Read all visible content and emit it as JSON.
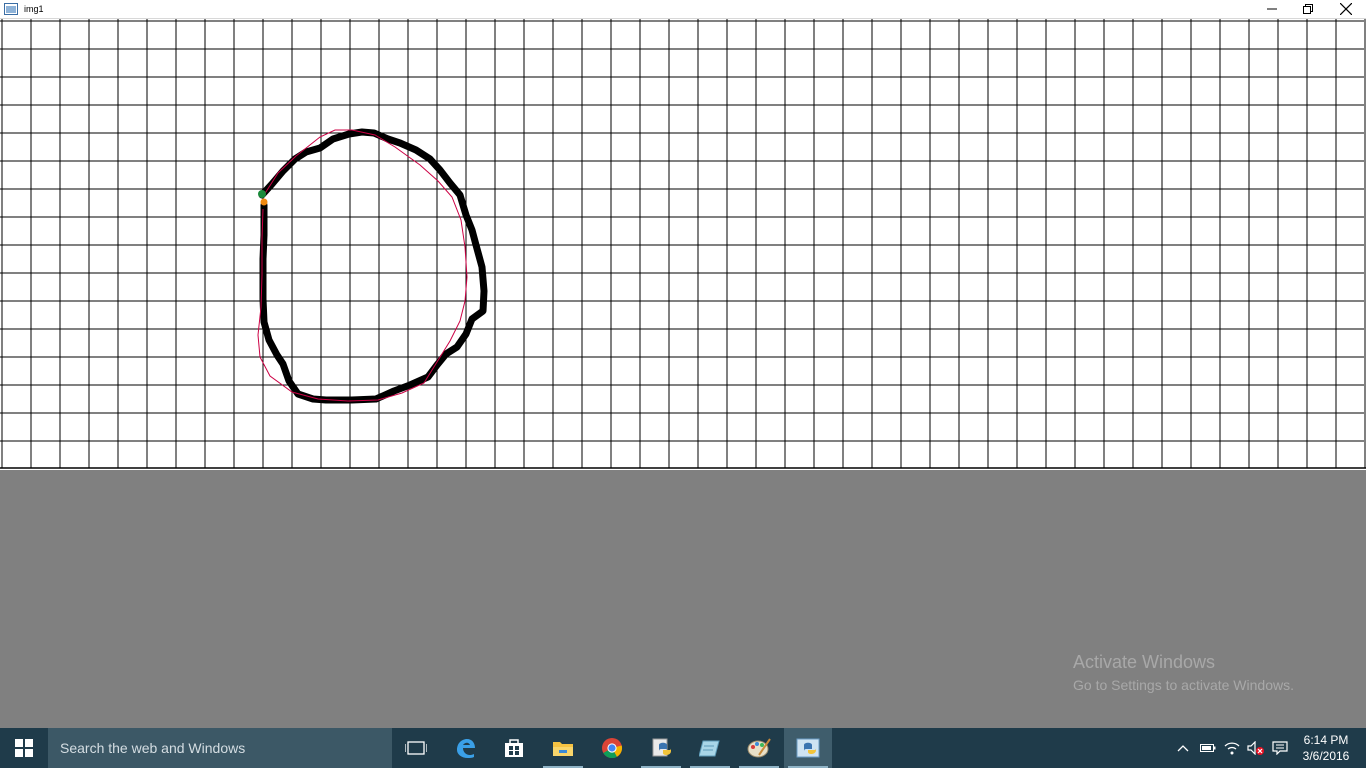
{
  "window": {
    "title": "img1"
  },
  "desktop": {
    "watermark_title": "Activate Windows",
    "watermark_subtitle": "Go to Settings to activate Windows."
  },
  "taskbar": {
    "search_placeholder": "Search the web and Windows",
    "pinned": [
      "task-view-icon",
      "edge-icon",
      "store-icon",
      "file-explorer-icon",
      "chrome-icon",
      "python-icon",
      "notepad-icon",
      "paint-icon",
      "python-window-icon"
    ],
    "tray": [
      "show-hidden-icons",
      "battery-icon",
      "wifi-icon",
      "volume-muted-icon",
      "action-center-icon"
    ],
    "time": "6:14 PM",
    "date": "3/6/2016"
  },
  "colors": {
    "taskbar": "#1f3b4a",
    "desktop": "#808080",
    "stroke": "#000000",
    "trace": "#cc0044",
    "start_dot": "#1a8a3a",
    "end_dot": "#f08a10"
  }
}
